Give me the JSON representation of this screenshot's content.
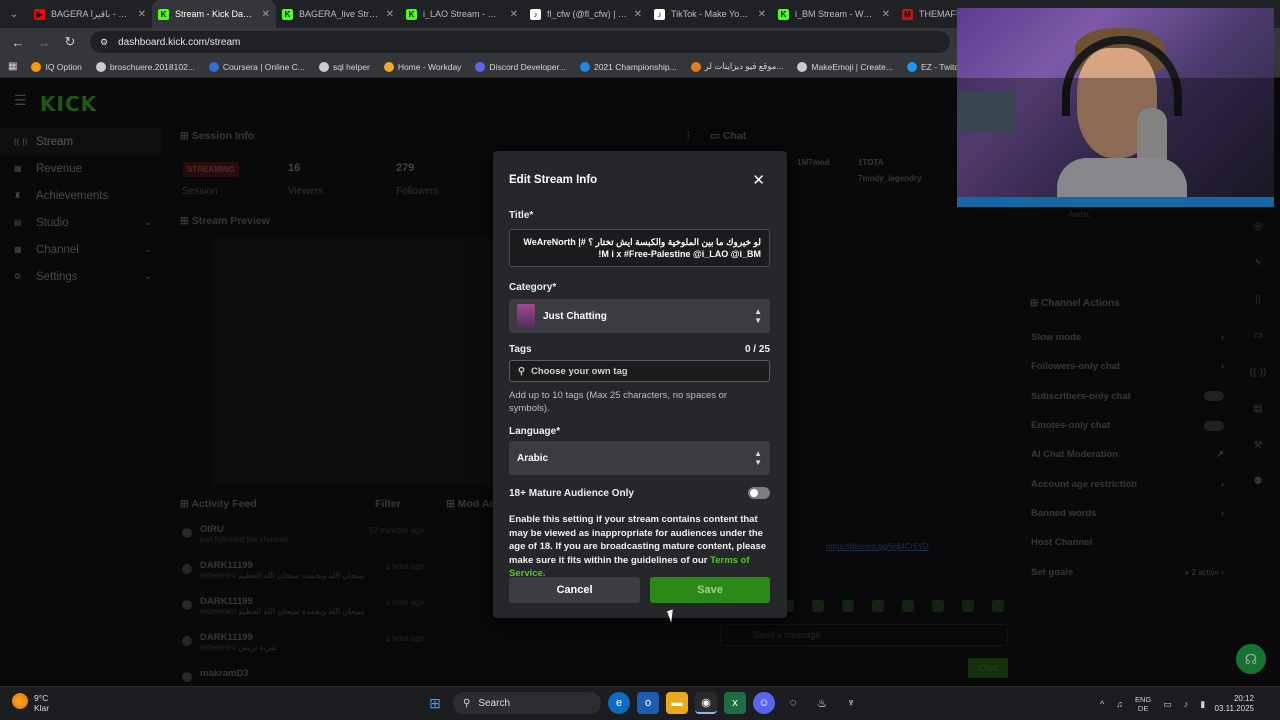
{
  "browser": {
    "tabs": [
      {
        "label": "BAGERA باقيرا - YouTu",
        "color": "#ff0000",
        "glyph": "▶"
      },
      {
        "label": "Stream - Kick Dashbo",
        "color": "#53fc18",
        "glyph": "K",
        "active": true
      },
      {
        "label": "BAGERA_live Stream",
        "color": "#53fc18",
        "glyph": "K"
      },
      {
        "label": "i_LAO Stream - Watch",
        "color": "#53fc18",
        "glyph": "K"
      },
      {
        "label": "fl_cfw (@fl_cfw) | TikT",
        "color": "#ffffff",
        "glyph": "♪"
      },
      {
        "label": "TikTok - Make Your D",
        "color": "#ffffff",
        "glyph": "♪"
      },
      {
        "label": "i_BM Stream - Watch",
        "color": "#53fc18",
        "glyph": "K"
      },
      {
        "label": "THEMAFIA.AE",
        "color": "#b71c1c",
        "glyph": "M"
      }
    ],
    "url": "dashboard.kick.com/stream",
    "bookmarks": [
      {
        "label": "IQ Option",
        "color": "#f59b00"
      },
      {
        "label": "broschuere.2018102...",
        "color": "#cccccc"
      },
      {
        "label": "Coursera | Online C...",
        "color": "#2a73cc"
      },
      {
        "label": "sql helper",
        "color": "#cccccc"
      },
      {
        "label": "Home - Workday",
        "color": "#f5a623"
      },
      {
        "label": "Discord Developer...",
        "color": "#5865f2"
      },
      {
        "label": "2021 Championship...",
        "color": "#1e88e5"
      },
      {
        "label": "موقع فيو ديزاينات لر...",
        "color": "#e67e22"
      },
      {
        "label": "MakeEmoji | Create...",
        "color": "#cccccc"
      },
      {
        "label": "EZ - Twitch Emote",
        "color": "#2196f3"
      }
    ]
  },
  "sidebar": {
    "items": [
      {
        "label": "Stream",
        "icon": "stream-icon",
        "active": true
      },
      {
        "label": "Revenue",
        "icon": "revenue-icon"
      },
      {
        "label": "Achievements",
        "icon": "trophy-icon"
      },
      {
        "label": "Studio",
        "icon": "studio-icon",
        "expandable": true
      },
      {
        "label": "Channel",
        "icon": "channel-icon",
        "expandable": true
      },
      {
        "label": "Settings",
        "icon": "gear-icon",
        "expandable": true
      }
    ]
  },
  "background": {
    "session_info": "Session Info",
    "streaming_badge": "STREAMING",
    "session_label": "Session",
    "viewers_value": "16",
    "viewers_label": "Viewers",
    "followers_value": "279",
    "followers_label": "Followers",
    "stream_preview": "Stream Preview",
    "activity_feed": "Activity Feed",
    "filter": "Filter",
    "mod_actions": "Mod Act",
    "feed": [
      {
        "who": "OIRU",
        "what": "just followed the channel",
        "when": "57 minutes ago"
      },
      {
        "who": "DARK11199",
        "what": "redeemed",
        "extra": "سبحان الله وبحمده سبحان الله العظيم",
        "when": "1 hour ago"
      },
      {
        "who": "DARK11199",
        "what": "redeemed",
        "extra": "سبحان الله وبحمده سبحان الله العظيم",
        "when": "1 hour ago"
      },
      {
        "who": "DARK11199",
        "what": "redeemed",
        "extra": "شربة تريس",
        "when": "1 hour ago"
      },
      {
        "who": "makramD3",
        "what": "",
        "when": ""
      }
    ],
    "chat": "Chat",
    "chat_users": [
      "1M7mod",
      "1TOTA",
      "7mody_legendry"
    ],
    "chat_lang": "Arabic",
    "chat_link": "https://discord.gg/6qMCr5YD",
    "send_placeholder": "Send a message",
    "chat_button": "Chat"
  },
  "channel_actions": {
    "title": "Channel Actions",
    "items": [
      {
        "label": "Slow mode",
        "control": "chevron"
      },
      {
        "label": "Followers-only chat",
        "control": "chevron"
      },
      {
        "label": "Subscribers-only chat",
        "control": "toggle"
      },
      {
        "label": "Emotes-only chat",
        "control": "toggle"
      },
      {
        "label": "AI Chat Moderation",
        "control": "icon"
      },
      {
        "label": "Account age restriction",
        "control": "chevron"
      },
      {
        "label": "Banned words",
        "control": "chevron"
      },
      {
        "label": "Host Channel",
        "control": "none"
      },
      {
        "label": "Set goals",
        "control": "goals",
        "extra": "2 active"
      }
    ]
  },
  "modal": {
    "title": "Edit Stream Info",
    "title_label": "Title*",
    "title_value": "لو خيروك ما بين الملوخية والكبسة ايش تختار ؟ #WeAreNorth | !M i x  #Free-Palestine @i_LAO @i_BM",
    "category_label": "Category*",
    "category_value": "Just Chatting",
    "tags_label": "Tags",
    "tags_count": "0 / 25",
    "tags_placeholder": "Choose your own tag",
    "tags_hint": "Add up to 10 tags (Max 25 characters, no spaces or symbols).",
    "language_label": "Language*",
    "language_value": "Arabic",
    "mature_label": "18+ Mature Audience Only",
    "mature_enabled": false,
    "mature_desc": "Enable this setting if your stream contains content that may be viewed as inappropriate for audiences under the age of 18. If you are broadcasting mature content, please make sure it fits within the guidelines of our ",
    "terms_link": "Terms of Service.",
    "cancel": "Cancel",
    "save": "Save"
  },
  "taskbar": {
    "temp": "9°C",
    "weather": "Klar",
    "search": "Search",
    "lang_top": "ENG",
    "lang_bottom": "DE",
    "time": "20:12",
    "date": "03.11.2025"
  },
  "colors": {
    "kick_green": "#53fc18",
    "save_green": "#2b8a17",
    "link_green": "#53c628"
  }
}
